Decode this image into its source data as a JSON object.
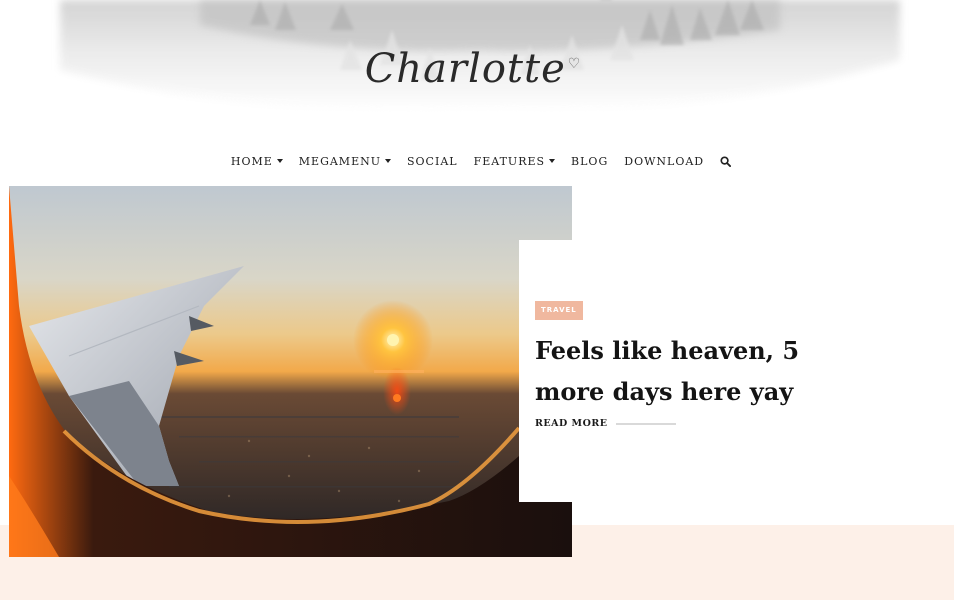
{
  "site": {
    "logo_text": "Charlotte",
    "logo_heart": "♡"
  },
  "nav": {
    "items": [
      {
        "label": "HOME",
        "has_dropdown": true
      },
      {
        "label": "MEGAMENU",
        "has_dropdown": true
      },
      {
        "label": "SOCIAL",
        "has_dropdown": false
      },
      {
        "label": "FEATURES",
        "has_dropdown": true
      },
      {
        "label": "BLOG",
        "has_dropdown": false
      },
      {
        "label": "DOWNLOAD",
        "has_dropdown": false
      }
    ],
    "search_icon": "search-icon"
  },
  "featured_post": {
    "category": "TRAVEL",
    "title": "Feels like heaven, 5 more days here yay",
    "read_more": "READ MORE",
    "image": "airplane-window-sunset"
  },
  "colors": {
    "accent": "#f0b89f",
    "band": "#fdf0e8",
    "text": "#141414"
  }
}
